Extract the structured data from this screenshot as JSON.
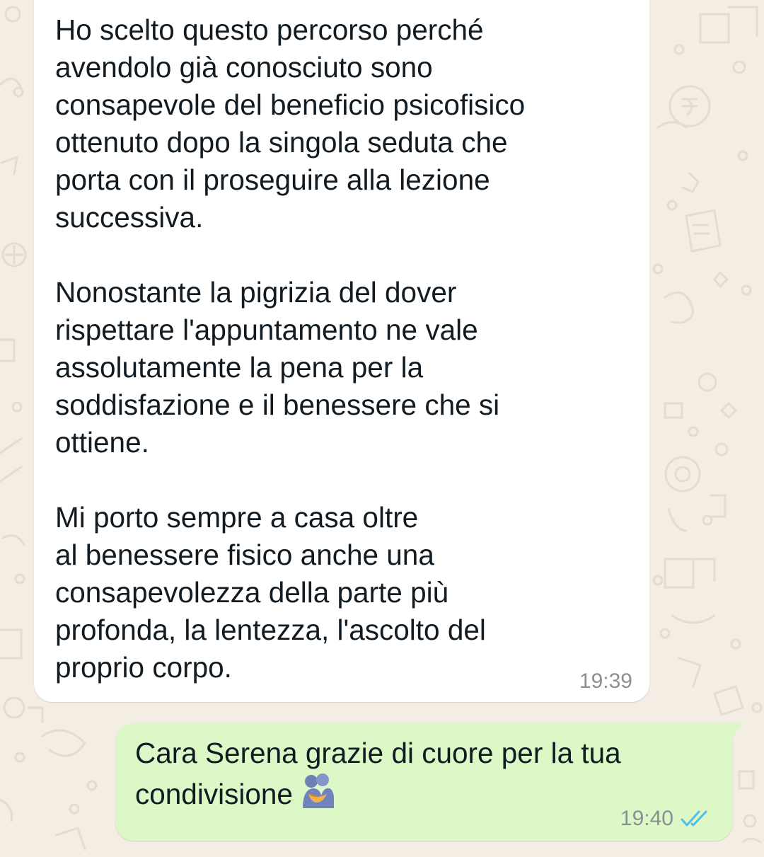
{
  "chat": {
    "messages": [
      {
        "direction": "incoming",
        "text": "Ho scelto questo percorso perché\navendolo già conosciuto sono\nconsapevole del beneficio psicofisico\nottenuto dopo la singola seduta che\nporta con il proseguire alla lezione\nsuccessiva.\n\nNonostante la pigrizia del dover\nrispettare l'appuntamento ne vale\nassolutamente la pena per la\nsoddisfazione e il benessere che si\nottiene.\n\nMi porto sempre a casa oltre\nal benessere fisico anche una\nconsapevolezza della parte più\nprofonda, la lentezza, l'ascolto del\nproprio corpo.",
        "time": "19:39"
      },
      {
        "direction": "outgoing",
        "text": "Cara Serena grazie di cuore per la tua\ncondivisione",
        "emoji": "people-hugging-emoji",
        "time": "19:40",
        "status": "read-double-check-icon"
      }
    ]
  },
  "colors": {
    "wallpaper": "#f3ede4",
    "incoming_bubble": "#ffffff",
    "outgoing_bubble": "#dcf8c6",
    "text": "#111b21",
    "meta_text": "#8a8f93",
    "read_ticks": "#53bdeb"
  }
}
